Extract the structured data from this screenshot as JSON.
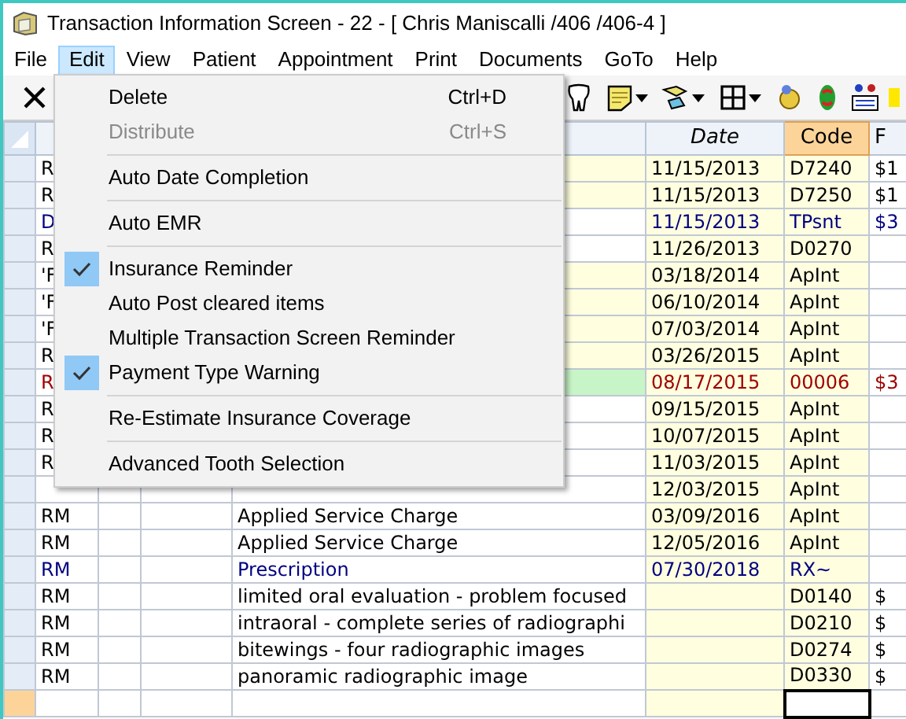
{
  "window": {
    "title": "Transaction Information Screen - 22 - [ Chris Maniscalli /406 /406-4 ]"
  },
  "menubar": [
    {
      "label": "File",
      "selected": false
    },
    {
      "label": "Edit",
      "selected": true
    },
    {
      "label": "View",
      "selected": false
    },
    {
      "label": "Patient",
      "selected": false
    },
    {
      "label": "Appointment",
      "selected": false
    },
    {
      "label": "Print",
      "selected": false
    },
    {
      "label": "Documents",
      "selected": false
    },
    {
      "label": "GoTo",
      "selected": false
    },
    {
      "label": "Help",
      "selected": false
    }
  ],
  "edit_menu": [
    {
      "kind": "item",
      "label": "Delete",
      "shortcut": "Ctrl+D",
      "disabled": false,
      "checked": false
    },
    {
      "kind": "item",
      "label": "Distribute",
      "shortcut": "Ctrl+S",
      "disabled": true,
      "checked": false
    },
    {
      "kind": "separator"
    },
    {
      "kind": "item",
      "label": "Auto Date Completion",
      "disabled": false,
      "checked": false
    },
    {
      "kind": "separator"
    },
    {
      "kind": "item",
      "label": "Auto EMR",
      "disabled": false,
      "checked": false
    },
    {
      "kind": "separator"
    },
    {
      "kind": "item",
      "label": "Insurance Reminder",
      "disabled": false,
      "checked": true
    },
    {
      "kind": "item",
      "label": "Auto Post cleared items",
      "disabled": false,
      "checked": false
    },
    {
      "kind": "item",
      "label": "Multiple Transaction Screen Reminder",
      "disabled": false,
      "checked": false
    },
    {
      "kind": "item",
      "label": "Payment Type Warning",
      "disabled": false,
      "checked": true
    },
    {
      "kind": "separator"
    },
    {
      "kind": "item",
      "label": "Re-Estimate Insurance Coverage",
      "disabled": false,
      "checked": false
    },
    {
      "kind": "separator"
    },
    {
      "kind": "item",
      "label": "Advanced Tooth Selection",
      "disabled": false,
      "checked": false
    }
  ],
  "table": {
    "columns": [
      {
        "label": "Date",
        "sorted": false
      },
      {
        "label": "Code",
        "sorted": true
      },
      {
        "label": "F",
        "sorted": false
      }
    ],
    "rows": [
      {
        "col1": "R",
        "date": "11/15/2013",
        "code": "D7240",
        "fee": "$1",
        "color": "#000000",
        "highlighted": true,
        "selected": false,
        "current": false
      },
      {
        "col1": "R",
        "date": "11/15/2013",
        "code": "D7250",
        "fee": "$1",
        "color": "#000000",
        "highlighted": true,
        "selected": false,
        "current": false
      },
      {
        "col1": "D",
        "date": "11/15/2013",
        "code": "TPsnt",
        "fee": "$3",
        "color": "#000080",
        "highlighted": false,
        "selected": false,
        "current": false
      },
      {
        "col1": "R",
        "date": "11/26/2013",
        "code": "D0270",
        "color": "#000000",
        "highlighted": false,
        "selected": false,
        "current": false
      },
      {
        "col1": "'F",
        "date": "03/18/2014",
        "code": "ApInt",
        "color": "#000000",
        "highlighted": true,
        "selected": false,
        "current": false
      },
      {
        "col1": "'F",
        "date": "06/10/2014",
        "code": "ApInt",
        "color": "#000000",
        "highlighted": true,
        "selected": false,
        "current": false
      },
      {
        "col1": "'F",
        "date": "07/03/2014",
        "code": "ApInt",
        "color": "#000000",
        "highlighted": true,
        "selected": false,
        "current": false
      },
      {
        "col1": "R",
        "date": "03/26/2015",
        "code": "ApInt",
        "color": "#000000",
        "highlighted": true,
        "selected": false,
        "current": false
      },
      {
        "col1": "R",
        "date": "08/17/2015",
        "code": "00006",
        "fee": "$3",
        "color": "#a00000",
        "highlighted": false,
        "selected": true,
        "current": false
      },
      {
        "col1": "R",
        "date": "09/15/2015",
        "code": "ApInt",
        "color": "#000000",
        "highlighted": false,
        "selected": false,
        "current": false
      },
      {
        "col1": "R",
        "date": "10/07/2015",
        "code": "ApInt",
        "color": "#000000",
        "highlighted": false,
        "selected": false,
        "current": false
      },
      {
        "col1": "R",
        "date": "11/03/2015",
        "code": "ApInt",
        "color": "#000000",
        "highlighted": false,
        "selected": false,
        "current": false
      },
      {
        "date": "12/03/2015",
        "code": "ApInt",
        "color": "#000000",
        "highlighted": false,
        "selected": false,
        "current": false
      },
      {
        "col1": "RM",
        "description": "Applied Service Charge",
        "date": "03/09/2016",
        "code": "ApInt",
        "color": "#000000",
        "highlighted": false,
        "selected": false,
        "current": false
      },
      {
        "col1": "RM",
        "description": "Applied Service Charge",
        "date": "12/05/2016",
        "code": "ApInt",
        "color": "#000000",
        "highlighted": false,
        "selected": false,
        "current": false
      },
      {
        "col1": "RM",
        "description": "Prescription",
        "date": "07/30/2018",
        "code": "RX~",
        "color": "#000080",
        "highlighted": false,
        "selected": false,
        "current": false
      },
      {
        "col1": "RM",
        "description": "limited oral evaluation - problem focused",
        "code": "D0140",
        "fee": "$",
        "color": "#000000",
        "highlighted": false,
        "selected": false,
        "current": false
      },
      {
        "col1": "RM",
        "description": "intraoral - complete series of radiographi",
        "code": "D0210",
        "fee": "$",
        "color": "#000000",
        "highlighted": false,
        "selected": false,
        "current": false
      },
      {
        "col1": "RM",
        "description": "bitewings - four radiographic images",
        "code": "D0274",
        "fee": "$",
        "color": "#000000",
        "highlighted": false,
        "selected": false,
        "current": false
      },
      {
        "col1": "RM",
        "description": "panoramic radiographic image",
        "code": "D0330",
        "fee": "$",
        "color": "#000000",
        "highlighted": false,
        "selected": false,
        "current": false
      },
      {
        "current": true
      }
    ]
  }
}
